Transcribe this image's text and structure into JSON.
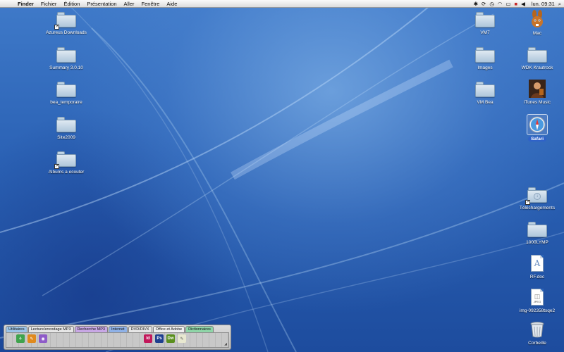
{
  "menubar": {
    "apple_icon": "apple-icon",
    "menus": [
      "Finder",
      "Fichier",
      "Édition",
      "Présentation",
      "Aller",
      "Fenêtre",
      "Aide"
    ],
    "status_icons": [
      "bluetooth-icon",
      "sync-icon",
      "time-machine-icon",
      "wifi-icon",
      "battery-icon",
      "flag-icon",
      "volume-icon"
    ],
    "clock": "lun. 09:31",
    "spotlight_icon": "spotlight-icon"
  },
  "desktop_left": [
    {
      "label": "Azureus Downloads",
      "alias": true
    },
    {
      "label": "Summary 3.0.10",
      "alias": false
    },
    {
      "label": "bea_temporaire",
      "alias": false
    },
    {
      "label": "Site2009",
      "alias": false
    },
    {
      "label": "Albums a ecouter",
      "alias": true
    }
  ],
  "desktop_mid": [
    {
      "label": "VM7"
    },
    {
      "label": "Images"
    },
    {
      "label": "VM Bea"
    }
  ],
  "desktop_right": {
    "mac": "Mac",
    "wdk": "WDK Krautrock",
    "itunes": "iTunes Music",
    "safari": "Safari",
    "telechargements": "Téléchargements",
    "olymp": "1000LYMP",
    "rf": "RF.doc",
    "img": "img-092358tsqe2",
    "trash": "Corbeille"
  },
  "drawer": {
    "tabs": [
      {
        "label": "Utilitaires",
        "color": "#9cc4e8"
      },
      {
        "label": "Lecture/encodage MP3",
        "color": "#e6e6e6"
      },
      {
        "label": "Recherche MP3",
        "color": "#c9a8e6"
      },
      {
        "label": "Internet",
        "color": "#8fb2e8"
      },
      {
        "label": "DVD/DIVX",
        "color": "#e6e6e6"
      },
      {
        "label": "Office et Adobe",
        "color": "#f0f0f0"
      },
      {
        "label": "Dictionnaires",
        "color": "#8fd6a8"
      }
    ],
    "left_icons": [
      "green-app-icon",
      "orange-app-icon",
      "purple-app-icon"
    ],
    "right_icons": [
      {
        "name": "indesign-icon",
        "text": "Id",
        "color": "#c2185b"
      },
      {
        "name": "photoshop-icon",
        "text": "Ps",
        "color": "#1e3f8f"
      },
      {
        "name": "dreamweaver-icon",
        "text": "Dw",
        "color": "#5a8f1e"
      },
      {
        "name": "textedit-icon",
        "text": "✎",
        "color": "#e8e8d0"
      }
    ]
  }
}
